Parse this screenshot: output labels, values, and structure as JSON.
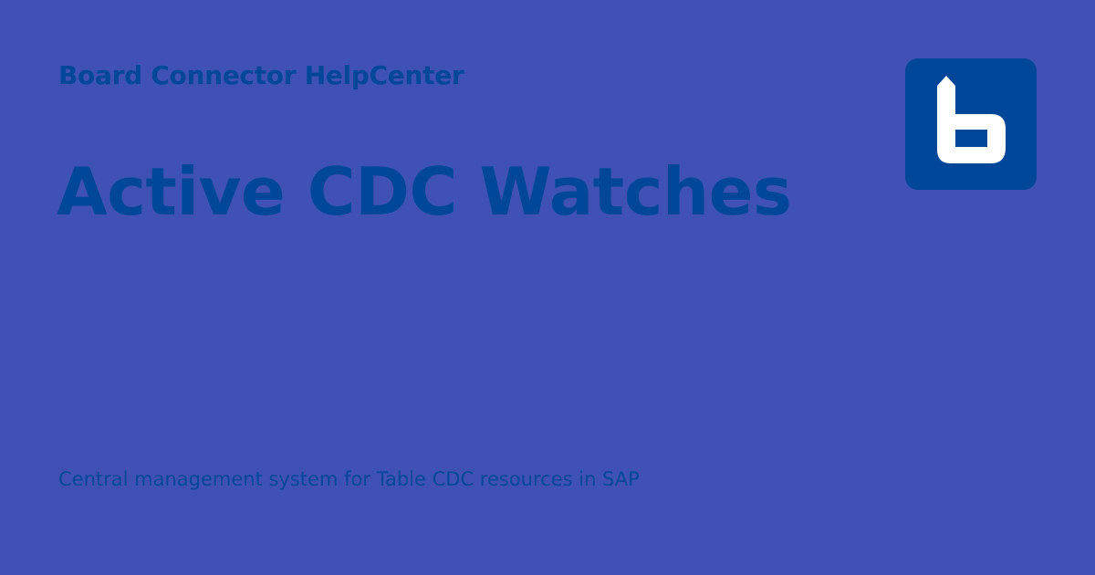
{
  "header": {
    "site_name": "Board Connector HelpCenter",
    "logo_icon": "board-logo-icon"
  },
  "main": {
    "title": "Active CDC Watches",
    "description": "Central management system for Table CDC resources in SAP"
  },
  "colors": {
    "background": "#3f51b5",
    "text": "#00479a",
    "logo_background": "#00479a",
    "logo_mark": "#ffffff"
  }
}
